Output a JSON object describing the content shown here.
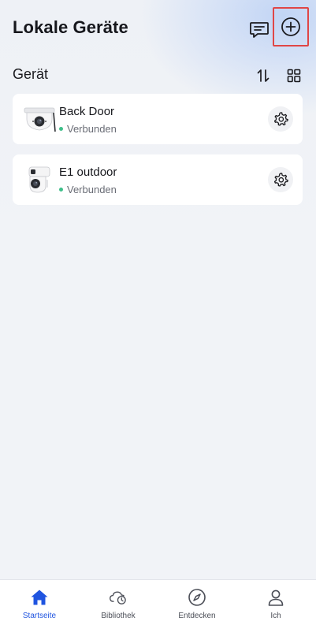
{
  "header": {
    "title": "Lokale Geräte",
    "message_icon": "message-icon",
    "add_icon": "add-circle-icon"
  },
  "section": {
    "title": "Gerät",
    "sort_icon": "sort-icon",
    "grid_icon": "grid-view-icon"
  },
  "devices": [
    {
      "name": "Back Door",
      "status": "Verbunden",
      "thumb_icon": "dome-camera-icon",
      "settings_icon": "gear-icon"
    },
    {
      "name": "E1 outdoor",
      "status": "Verbunden",
      "thumb_icon": "ptz-camera-icon",
      "settings_icon": "gear-icon"
    }
  ],
  "tabbar": {
    "tabs": [
      {
        "label": "Startseite",
        "icon": "home-icon",
        "active": true
      },
      {
        "label": "Bibliothek",
        "icon": "cloud-clock-icon",
        "active": false
      },
      {
        "label": "Entdecken",
        "icon": "compass-icon",
        "active": false
      },
      {
        "label": "Ich",
        "icon": "person-icon",
        "active": false
      }
    ]
  },
  "colors": {
    "accent": "#1f54e0",
    "status_connected": "#3fbf8a",
    "highlight_border": "#e04646"
  }
}
